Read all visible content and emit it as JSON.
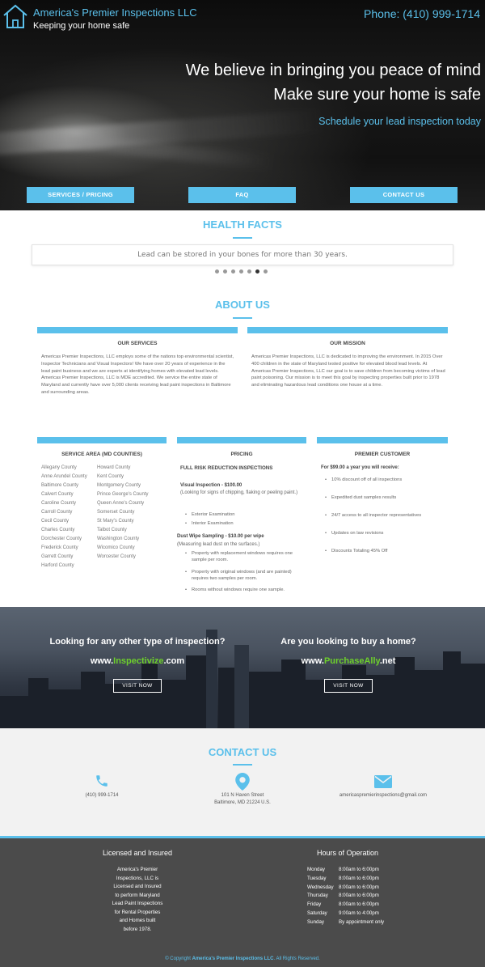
{
  "header": {
    "brand": "America's Premier Inspections LLC",
    "tagline": "Keeping your home safe",
    "phone": "Phone: (410) 999-1714"
  },
  "hero": {
    "line1": "We believe in bringing you peace of mind",
    "line2": "Make sure your home is safe",
    "cta": "Schedule your lead inspection today",
    "buttons": [
      "SERVICES / PRICING",
      "FAQ",
      "CONTACT US"
    ]
  },
  "health": {
    "title": "HEALTH FACTS",
    "fact": "Lead can be stored in your bones for more than 30 years.",
    "slide_count": 7,
    "active_slide": 6
  },
  "about": {
    "title": "ABOUT US",
    "services_title": "OUR SERVICES",
    "services_text": "Americas Premier Inspections, LLC employs some of the nations top environmental scientist, Inspector Technicians and Visual Inspectors! We have over 20 years of experience in the lead paint business and we are experts at identifying homes with elevated lead levels. Americas Premier Inspections, LLC is MDE accredited. We service the entire state of Maryland and currently have over 5,000 clients receiving lead paint inspections in Baltimore and surrounding areas.",
    "mission_title": "OUR MISSION",
    "mission_text": "Americas Premier Inspections, LLC is dedicated to improving the environment. In 2015 Over 400 children in the state of Maryland tested positive for elevated blood lead levels. At Americas Premier Inspections, LLC our goal is to save children from becoming victims of lead paint poisoning. Our mission is to meet this goal by inspecting properties built prior to 1978 and eliminating hazardous lead conditions one house at a time."
  },
  "service_area": {
    "title": "SERVICE AREA (MD COUNTIES)",
    "col1": [
      "Allegany County",
      "Anne Arundel County",
      "Baltimore County",
      "Calvert County",
      "Caroline County",
      "Carroll County",
      "Cecil County",
      "Charles County",
      "Dorchester County",
      "Frederick County",
      "Garrett County",
      "Harford County"
    ],
    "col2": [
      "Howard County",
      "Kent County",
      "Montgomery County",
      "Prince George's County",
      "Queen Anne's County",
      "Somerset County",
      "St Mary's County",
      "Talbot County",
      "Washington County",
      "Wicomico County",
      "Worcester County"
    ]
  },
  "pricing": {
    "title": "PRICING",
    "subtitle": "FULL RISK REDUCTION INSPECTIONS",
    "visual_title": "Visual Inspection - $100.00",
    "visual_note": "(Looking for signs of chipping, flaking or peeling paint.)",
    "visual_items": [
      "Exterior Examination",
      "Interior Examination"
    ],
    "dust_title": "Dust Wipe Sampling - $10.00 per wipe",
    "dust_note": "(Measuring lead dust on the surfaces.)",
    "dust_items": [
      "Property with replacement windows requires one sample per room.",
      "Property with original windows (and are painted) requires two samples per room.",
      "Rooms without windows require one sample."
    ]
  },
  "premier": {
    "title": "PREMIER CUSTOMER",
    "lead": "For $99.00 a year you will receive:",
    "items": [
      "10% discount off of all inspections",
      "Expedited dust samples results",
      "24/7 access to all inspector representatives",
      "Updates on law revisions",
      "Discounts Totaling 45% Off"
    ]
  },
  "city": {
    "q1": "Looking for any other type of inspection?",
    "url1_pre": "www.",
    "url1_hl": "Inspectivize",
    "url1_post": ".com",
    "q2": "Are you looking to buy a home?",
    "url2_pre": "www.",
    "url2_hl": "PurchaseAlly",
    "url2_post": ".net",
    "visit_label": "VISIT NOW"
  },
  "contact": {
    "title": "CONTACT US",
    "phone": "(410) 999-1714",
    "address1": "101 N Haven Street",
    "address2": "Baltimore, MD 21224 U.S.",
    "email": "americaspremierinspections@gmail.com",
    "icons": [
      "phone-icon",
      "map-pin-icon",
      "envelope-icon"
    ],
    "accent": "#5bc0eb"
  },
  "footer": {
    "licensed_title": "Licensed and Insured",
    "licensed_lines": [
      "America's Premier",
      "Inspections, LLC is",
      "Licensed and Insured",
      "to perform Maryland",
      "Lead Paint Inspections",
      "for Rental Properties",
      "and Homes built",
      "before 1978."
    ],
    "hours_title": "Hours of Operation",
    "hours": [
      {
        "day": "Monday",
        "time": "8:00am to 6:00pm"
      },
      {
        "day": "Tuesday",
        "time": "8:00am to 6:00pm"
      },
      {
        "day": "Wednesday",
        "time": "8:00am to 6:00pm"
      },
      {
        "day": "Thursday",
        "time": "8:00am to 6:00pm"
      },
      {
        "day": "Friday",
        "time": "8:00am to 6:00pm"
      },
      {
        "day": "Saturday",
        "time": "9:00am to 4:00pm"
      },
      {
        "day": "Sunday",
        "time": "By appointment only"
      }
    ],
    "copyright_pre": "© Copyright ",
    "copyright_name": "America's Premier Inspections LLC",
    "copyright_post": ". All Rights Reserved."
  }
}
